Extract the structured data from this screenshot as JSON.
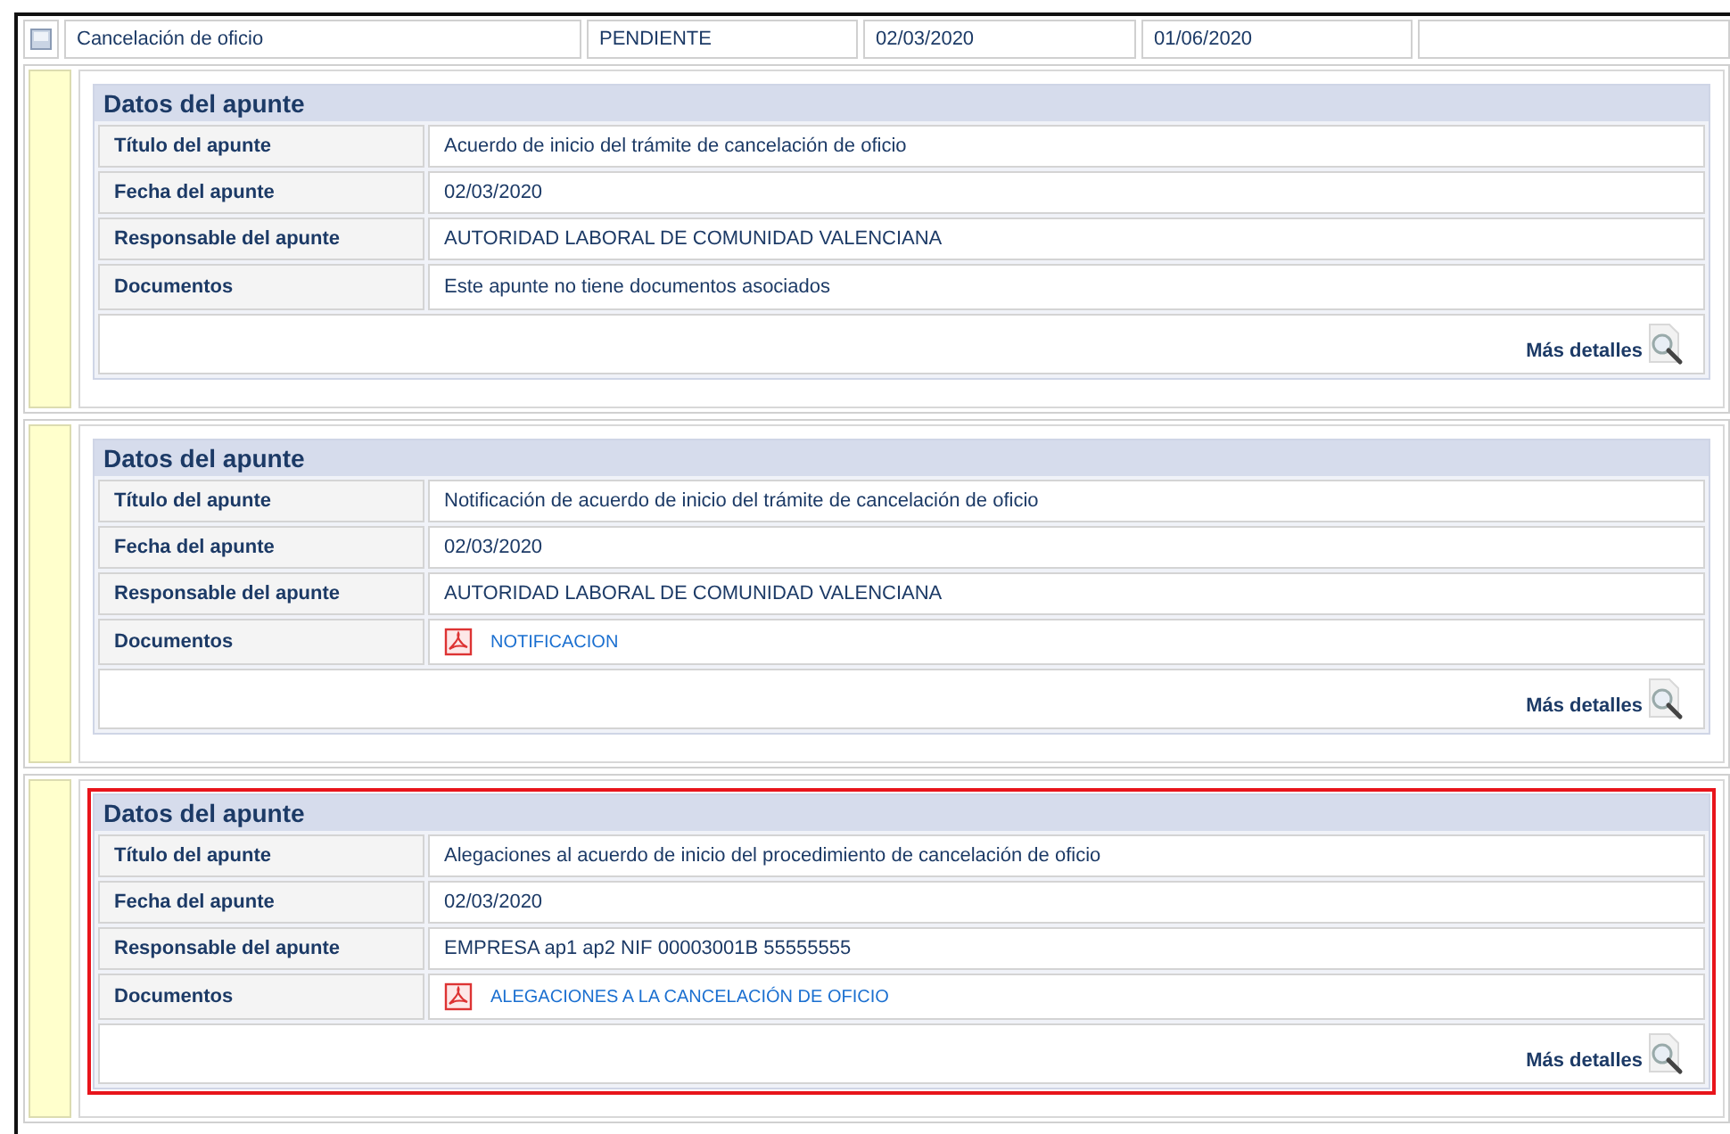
{
  "summary_row": {
    "name": "Cancelación de oficio",
    "status": "PENDIENTE",
    "start_date": "02/03/2020",
    "end_date": "01/06/2020"
  },
  "entries": [
    {
      "heading": "Datos del apunte",
      "selected": false,
      "fields": [
        {
          "label": "Título del apunte",
          "value": "Acuerdo de inicio del trámite de cancelación de oficio"
        },
        {
          "label": "Fecha del apunte",
          "value": "02/03/2020"
        },
        {
          "label": "Responsable del apunte",
          "value": "AUTORIDAD LABORAL DE COMUNIDAD VALENCIANA"
        }
      ],
      "documents": {
        "label": "Documentos",
        "kind": "text",
        "value": "Este apunte no tiene documentos asociados"
      },
      "details_link": "Más detalles"
    },
    {
      "heading": "Datos del apunte",
      "selected": false,
      "fields": [
        {
          "label": "Título del apunte",
          "value": "Notificación de acuerdo de inicio del trámite de cancelación de oficio"
        },
        {
          "label": "Fecha del apunte",
          "value": "02/03/2020"
        },
        {
          "label": "Responsable del apunte",
          "value": "AUTORIDAD LABORAL DE COMUNIDAD VALENCIANA"
        }
      ],
      "documents": {
        "label": "Documentos",
        "kind": "pdf",
        "value": "NOTIFICACION"
      },
      "details_link": "Más detalles"
    },
    {
      "heading": "Datos del apunte",
      "selected": true,
      "fields": [
        {
          "label": "Título del apunte",
          "value": "Alegaciones al acuerdo de inicio del procedimiento de cancelación de oficio"
        },
        {
          "label": "Fecha del apunte",
          "value": "02/03/2020"
        },
        {
          "label": "Responsable del apunte",
          "value": "EMPRESA ap1 ap2 NIF 00003001B  55555555"
        }
      ],
      "documents": {
        "label": "Documentos",
        "kind": "pdf",
        "value": "ALEGACIONES A LA CANCELACIÓN DE OFICIO"
      },
      "details_link": "Más detalles"
    }
  ]
}
